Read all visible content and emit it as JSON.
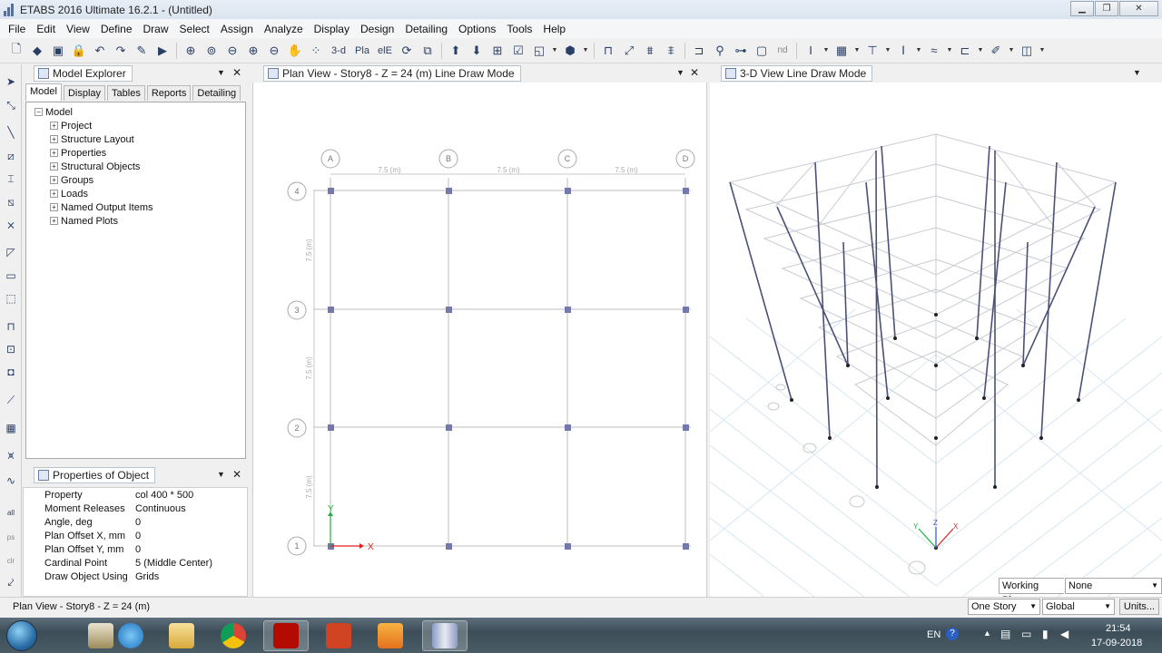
{
  "window": {
    "title": "ETABS 2016 Ultimate 16.2.1 - (Untitled)"
  },
  "menu": [
    "File",
    "Edit",
    "View",
    "Define",
    "Draw",
    "Select",
    "Assign",
    "Analyze",
    "Display",
    "Design",
    "Detailing",
    "Options",
    "Tools",
    "Help"
  ],
  "toolbar": {
    "three_d_label": "3-d",
    "pla_label": "Pla",
    "elev_label": "elE",
    "nd_label": "nd"
  },
  "model_explorer": {
    "title": "Model Explorer",
    "tabs": [
      "Model",
      "Display",
      "Tables",
      "Reports",
      "Detailing"
    ],
    "active_tab": "Model",
    "root": "Model",
    "items": [
      "Project",
      "Structure Layout",
      "Properties",
      "Structural Objects",
      "Groups",
      "Loads",
      "Named Output Items",
      "Named Plots"
    ]
  },
  "properties_panel": {
    "title": "Properties of Object",
    "rows": [
      {
        "key": "Property",
        "value": "col 400 * 500"
      },
      {
        "key": "Moment Releases",
        "value": "Continuous"
      },
      {
        "key": "Angle, deg",
        "value": "0"
      },
      {
        "key": "Plan Offset X, mm",
        "value": "0"
      },
      {
        "key": "Plan Offset Y, mm",
        "value": "0"
      },
      {
        "key": "Cardinal Point",
        "value": "5 (Middle Center)"
      },
      {
        "key": "Draw Object Using",
        "value": "Grids"
      }
    ]
  },
  "plan_view": {
    "title": "Plan View - Story8 - Z = 24 (m)  Line Draw Mode",
    "grid_x": [
      "A",
      "B",
      "C",
      "D"
    ],
    "grid_y": [
      "4",
      "3",
      "2",
      "1"
    ],
    "x_spacing_label": "7.5 (m)",
    "y_spacing_label": "7.5 (m)",
    "axis_x": "X",
    "axis_y": "Y"
  },
  "view3d": {
    "title": "3-D View  Line Draw Mode",
    "axis_labels": [
      "X",
      "Y",
      "Z"
    ]
  },
  "statusbar": {
    "text": "Plan View - Story8 - Z = 24 (m)",
    "working_plane_label": "Working Plane",
    "working_plane_value": "None",
    "story_option": "One Story",
    "coord_system": "Global",
    "units_button": "Units..."
  },
  "taskbar": {
    "lang": "EN",
    "time": "21:54",
    "date": "17-09-2018"
  },
  "colors": {
    "grid": "#b9b9b9",
    "joint": "#7378ad",
    "column3d": "#4b5077",
    "accent": "#3a78c8"
  }
}
